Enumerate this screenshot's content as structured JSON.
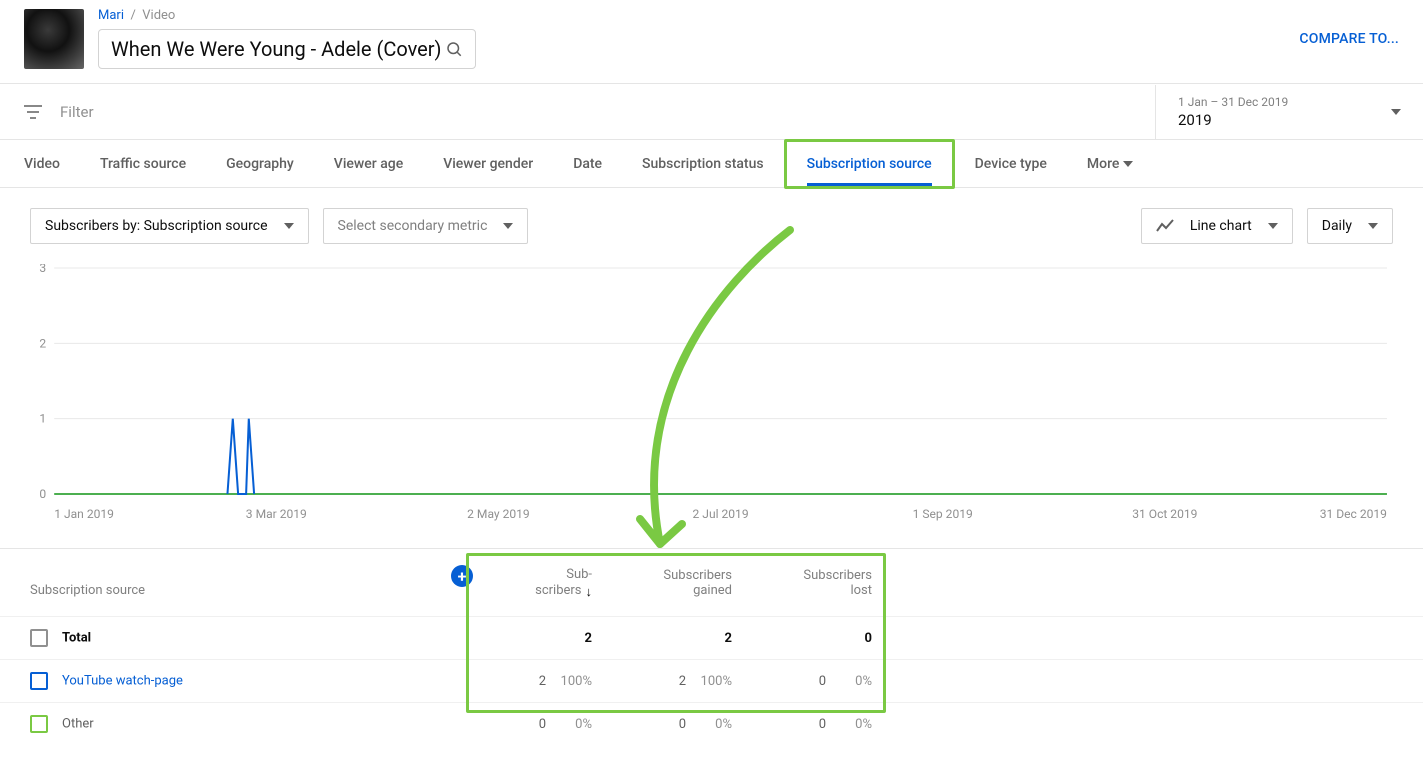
{
  "breadcrumb": {
    "channel": "Mari",
    "section": "Video"
  },
  "title": "When We Were Young - Adele (Cover)",
  "compare": "COMPARE TO...",
  "filter_placeholder": "Filter",
  "date": {
    "range": "1 Jan – 31 Dec 2019",
    "preset": "2019"
  },
  "tabs": {
    "items": [
      "Video",
      "Traffic source",
      "Geography",
      "Viewer age",
      "Viewer gender",
      "Date",
      "Subscription status",
      "Subscription source",
      "Device type"
    ],
    "more": "More",
    "active": "Subscription source"
  },
  "controls": {
    "primary": "Subscribers by: Subscription source",
    "secondary": "Select secondary metric",
    "chart_type": "Line chart",
    "granularity": "Daily"
  },
  "chart_data": {
    "type": "line",
    "x_ticks": [
      "1 Jan 2019",
      "3 Mar 2019",
      "2 May 2019",
      "2 Jul 2019",
      "1 Sep 2019",
      "31 Oct 2019",
      "31 Dec 2019"
    ],
    "y_ticks": [
      0,
      1,
      2,
      3
    ],
    "ylim": [
      0,
      3
    ],
    "series": [
      {
        "name": "YouTube watch-page",
        "color": "#065fd4",
        "points": [
          {
            "x": 0.134,
            "y": 1
          },
          {
            "x": 0.14,
            "y": 0
          },
          {
            "x": 0.146,
            "y": 1
          }
        ]
      },
      {
        "name": "Other",
        "color": "#4caf50",
        "points": []
      }
    ]
  },
  "table": {
    "header": {
      "src": "Subscription source",
      "c1a": "Sub-",
      "c1b": "scribers",
      "c2a": "Subscribers",
      "c2b": "gained",
      "c3a": "Subscribers",
      "c3b": "lost"
    },
    "total_label": "Total",
    "total": {
      "subs": "2",
      "gained": "2",
      "lost": "0"
    },
    "rows": [
      {
        "label": "YouTube watch-page",
        "color": "blue",
        "subs": "2",
        "subs_pct": "100%",
        "gained": "2",
        "gained_pct": "100%",
        "lost": "0",
        "lost_pct": "0%"
      },
      {
        "label": "Other",
        "color": "green",
        "subs": "0",
        "subs_pct": "0%",
        "gained": "0",
        "gained_pct": "0%",
        "lost": "0",
        "lost_pct": "0%"
      }
    ]
  }
}
